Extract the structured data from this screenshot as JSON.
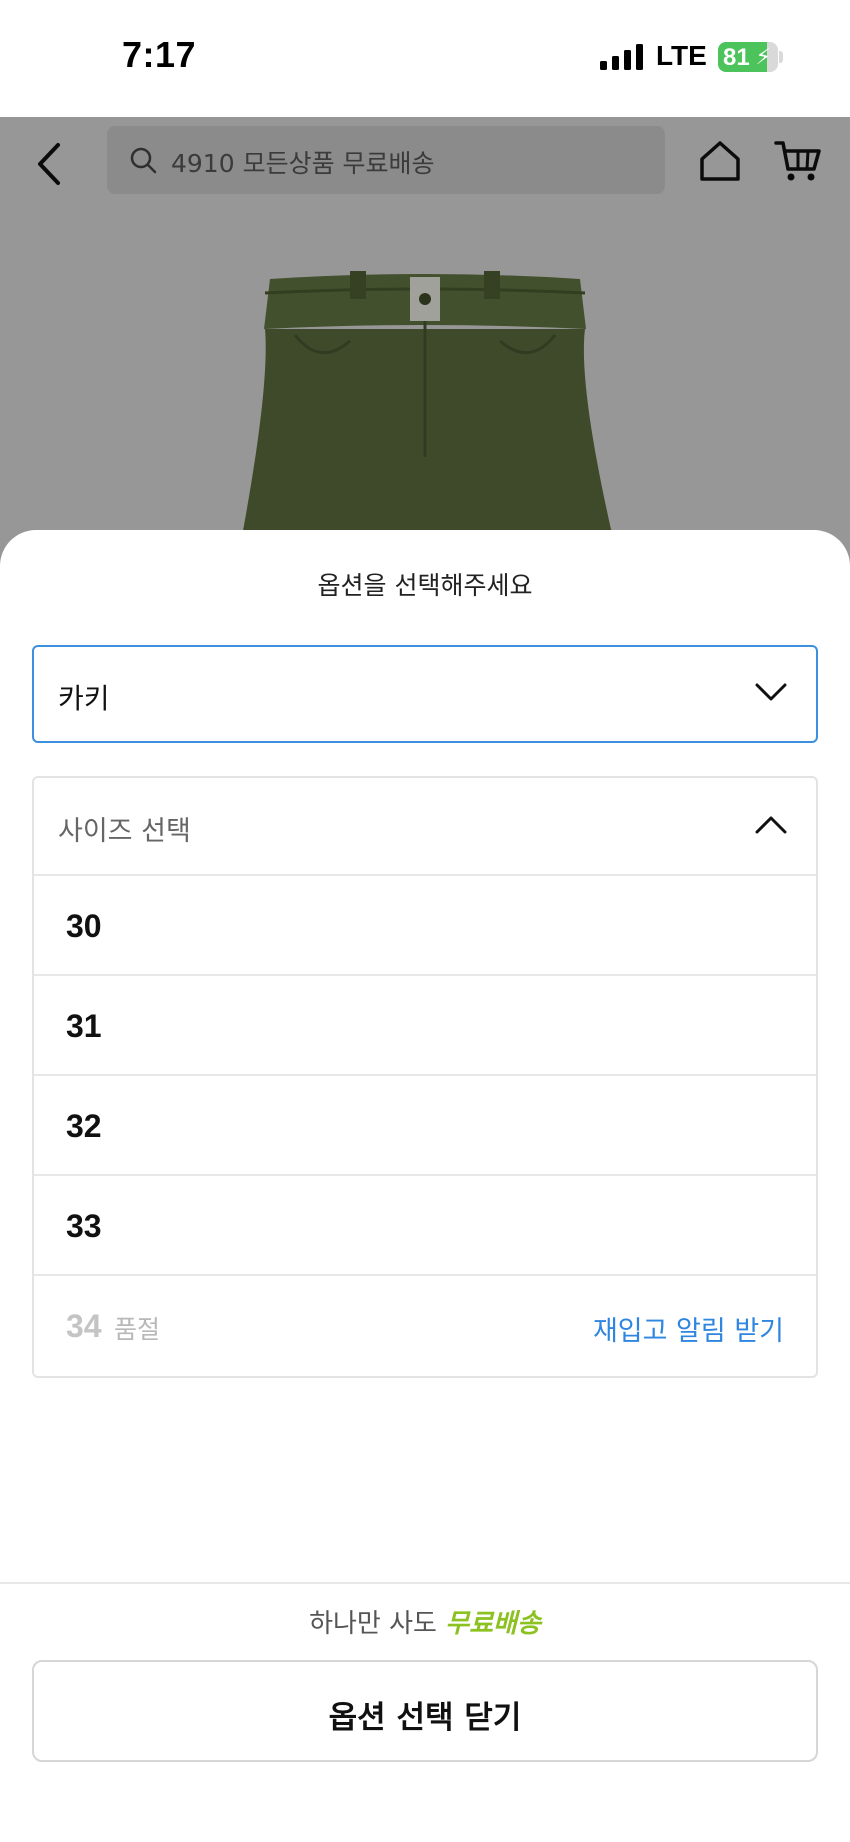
{
  "status_bar": {
    "time": "7:17",
    "network": "LTE",
    "battery_level": 81,
    "battery_text": "81"
  },
  "header": {
    "search_text": "4910 모든상품 무료배송"
  },
  "sheet": {
    "title": "옵션을 선택해주세요",
    "color_select": {
      "value": "카키"
    },
    "size_select": {
      "label": "사이즈 선택",
      "options": [
        {
          "value": "30"
        },
        {
          "value": "31"
        },
        {
          "value": "32"
        },
        {
          "value": "33"
        },
        {
          "value": "34",
          "soldout_label": "품절",
          "restock_label": "재입고 알림 받기"
        }
      ]
    },
    "promo": {
      "text": "하나만 사도",
      "highlight": "무료배송"
    },
    "close_button": "옵션 선택 닫기"
  },
  "colors": {
    "accent_blue": "#2f86e0",
    "promo_green": "#8bc120",
    "battery_green": "#4cc35b"
  }
}
